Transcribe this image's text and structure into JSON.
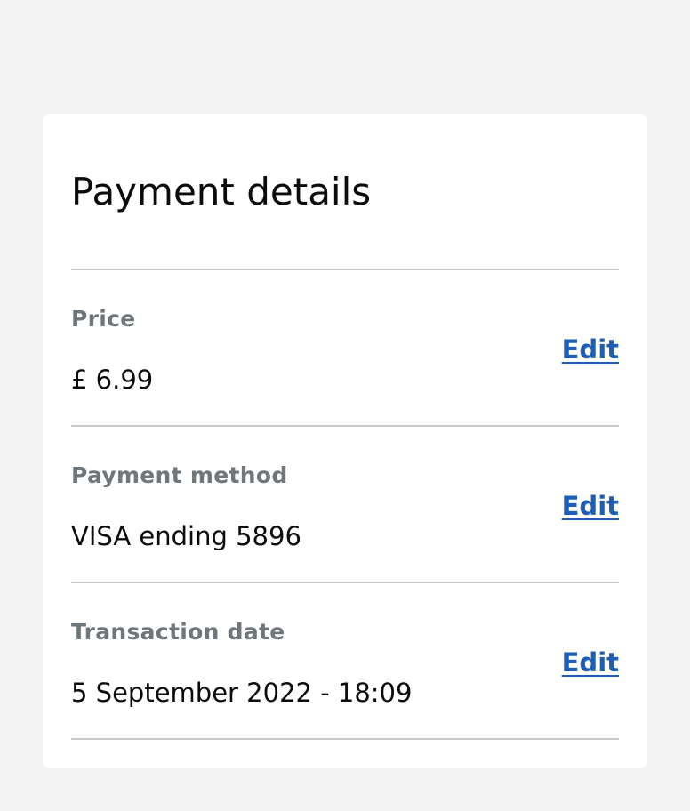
{
  "card": {
    "title": "Payment details",
    "rows": [
      {
        "label": "Price",
        "value": "£ 6.99",
        "action": "Edit"
      },
      {
        "label": "Payment method",
        "value": "VISA ending 5896",
        "action": "Edit"
      },
      {
        "label": "Transaction date",
        "value": "5 September 2022 - 18:09",
        "action": "Edit"
      }
    ]
  },
  "colors": {
    "page_background": "#f3f3f3",
    "card_background": "#ffffff",
    "label": "#6f777b",
    "text": "#0b0c0c",
    "link": "#1d5fb8",
    "divider": "#c8c8c8"
  }
}
